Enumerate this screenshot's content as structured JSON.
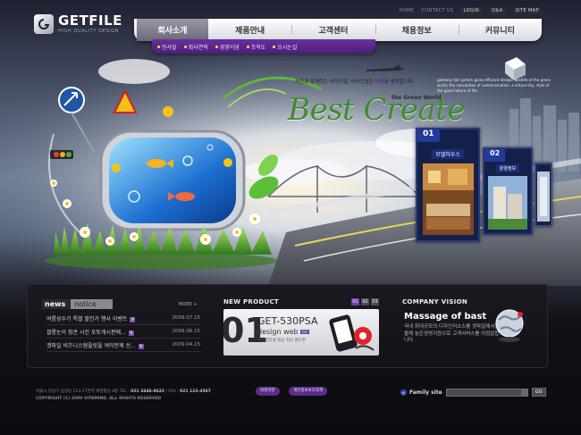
{
  "logo": {
    "name": "GETFILE",
    "tagline": "HIGH QUALITY DESIGN"
  },
  "top_links": [
    "HOME",
    "CONTACT US",
    "LOGIN",
    "Q&A",
    "SITE MAP"
  ],
  "nav": {
    "items": [
      "회사소개",
      "제품안내",
      "고객센터",
      "채용정보",
      "커뮤니티"
    ],
    "active": "회사소개"
  },
  "subnav": [
    "인사말",
    "회사연혁",
    "경영이념",
    "조직도",
    "오시는길"
  ],
  "hero": {
    "tagline_prefix": "자연과 함께하는 비타건설,  비타건설은",
    "tagline_em": "미래를",
    "tagline_suffix": "생각합니다.",
    "side_text": "gateway fall system gives efficient design. bestlife of the green world. the conception of communication. a virtual city, style of the good nature of life.",
    "headline": "Best Create",
    "subhead": "the Green World",
    "cards": [
      {
        "num": "01",
        "title": "모델하우스"
      },
      {
        "num": "02",
        "title": "분양정보"
      }
    ]
  },
  "news": {
    "tabs": [
      "news",
      "notice"
    ],
    "more": "MORE +",
    "items": [
      {
        "title": "여름성수기 특별 할인가 행사 이벤트",
        "date": "2009.07.15"
      },
      {
        "title": "쌀롱눈이 참관 시진 포토게시판에...",
        "date": "2009.06.15"
      },
      {
        "title": "겟파일 비즈니스템플릿을 여러분께 선...",
        "date": "2009.04.15"
      }
    ]
  },
  "new_product": {
    "title": "NEW PRODUCT",
    "pages": [
      "01",
      "02",
      "03"
    ],
    "big_number": "01",
    "code": "GET-530PSA",
    "subtitle": "design web",
    "go": "GO",
    "desc": "무선인터넷 최상 최신 핸드폰"
  },
  "company_vision": {
    "title": "COMPANY VISION",
    "headline": "Massage of bast",
    "text": "국내 최대규모의 디자인리소스를 겟파일에서는 올해 높은경영지원으로 고객서비스를 아낌없합니다."
  },
  "footer": {
    "address_prefix": "서울시 강남구 삼성동 123-17번지 벽절빌딩 4층  TEL :",
    "tel": "021 3446-8622",
    "fax_prefix": "/ FAX :",
    "fax": "021 123-4567",
    "copyright": "COPYRIGHT (C) 2009 VITAMIND. ALL RIGHTS RESERVED",
    "buttons": [
      "회원약관",
      "개인정보보호정책"
    ],
    "family_label": "Family site",
    "family_go": "GO"
  },
  "colors": {
    "accent": "#6a2f9f",
    "headline": "#3f8a2f",
    "card": "#223a9a"
  }
}
